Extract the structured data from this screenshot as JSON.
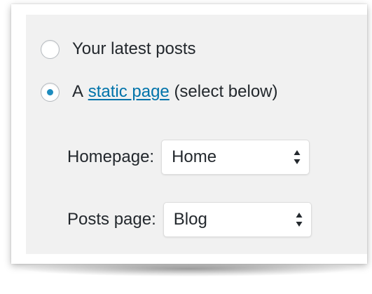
{
  "front_page_options": {
    "option_latest": {
      "label": "Your latest posts",
      "checked": false
    },
    "option_static": {
      "prefix": "A",
      "link_text": "static page",
      "suffix": "(select below)",
      "checked": true
    }
  },
  "homepage": {
    "label": "Homepage:",
    "selected": "Home"
  },
  "posts_page": {
    "label": "Posts page:",
    "selected": "Blog"
  },
  "colors": {
    "panel_background": "#f1f1f1",
    "link": "#0073aa",
    "radio_dot": "#1e8cbe",
    "text": "#23282d"
  }
}
